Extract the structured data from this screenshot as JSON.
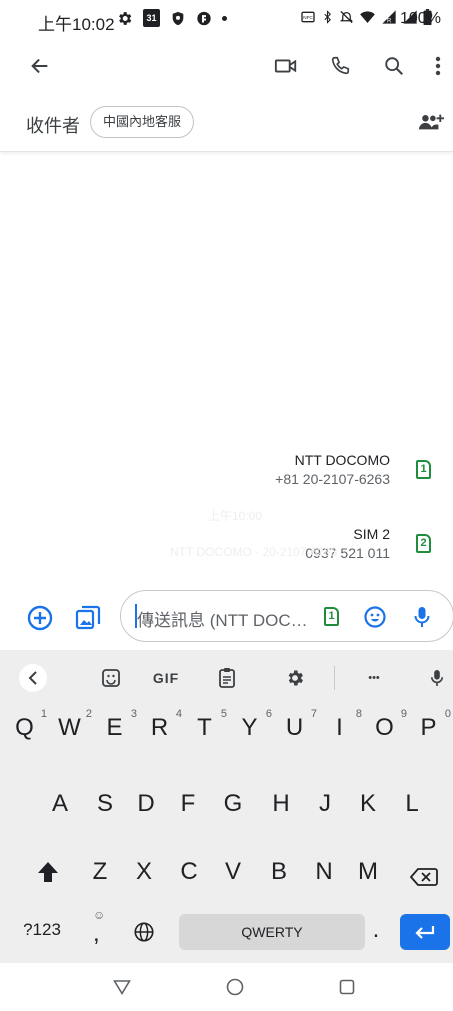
{
  "status_bar": {
    "time": "上午10:02",
    "calendar_day": "31",
    "battery": "100%"
  },
  "recipients": {
    "label": "收件者",
    "chip": "中國內地客服"
  },
  "sim_options": [
    {
      "name": "NTT DOCOMO",
      "number": "+81 20-2107-6263",
      "badge": "1"
    },
    {
      "name": "SIM 2",
      "number": "0937 521 011",
      "badge": "2"
    }
  ],
  "faded_timestamp": "上午10:00",
  "faded_message": "NTT DOCOMO · 20-2107-6263",
  "composer": {
    "placeholder": "傳送訊息 (NTT DOC…",
    "sim_badge": "1"
  },
  "keyboard": {
    "toolbar": {
      "gif": "GIF",
      "more": "•••"
    },
    "row1": [
      {
        "k": "Q",
        "h": "1"
      },
      {
        "k": "W",
        "h": "2"
      },
      {
        "k": "E",
        "h": "3"
      },
      {
        "k": "R",
        "h": "4"
      },
      {
        "k": "T",
        "h": "5"
      },
      {
        "k": "Y",
        "h": "6"
      },
      {
        "k": "U",
        "h": "7"
      },
      {
        "k": "I",
        "h": "8"
      },
      {
        "k": "O",
        "h": "9"
      },
      {
        "k": "P",
        "h": "0"
      }
    ],
    "row2": [
      "A",
      "S",
      "D",
      "F",
      "G",
      "H",
      "J",
      "K",
      "L"
    ],
    "row3": [
      "Z",
      "X",
      "C",
      "V",
      "B",
      "N",
      "M"
    ],
    "symbols_key": "?123",
    "comma_key": ",",
    "space_label": "QWERTY",
    "period_key": "."
  },
  "colors": {
    "accent_blue": "#1a73e8",
    "sim_green": "#1e8e3e"
  }
}
